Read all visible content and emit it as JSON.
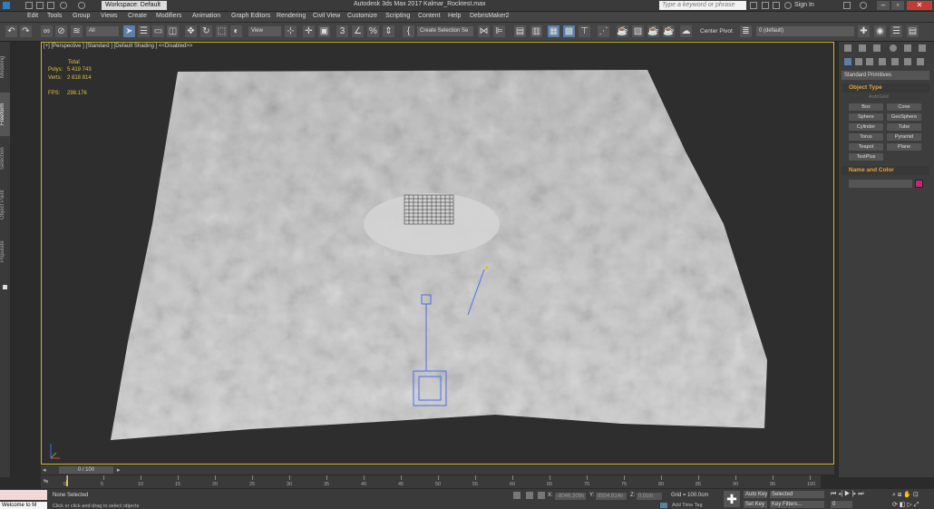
{
  "titlebar": {
    "workspace": "Workspace: Default",
    "title": "Autodesk 3ds Max 2017    Kalmar_Rocktest.max",
    "search_placeholder": "Type a keyword or phrase",
    "sign_in": "Sign In"
  },
  "menu": [
    "Edit",
    "Tools",
    "Group",
    "Views",
    "Create",
    "Modifiers",
    "Animation",
    "Graph Editors",
    "Rendering",
    "Civil View",
    "Customize",
    "Scripting",
    "Content",
    "Help",
    "DebrisMaker2"
  ],
  "toolbar": {
    "selection_filter": "All",
    "ref_coord": "View",
    "selection_set": "Create Selection Se",
    "center_pivot": "Center Pivot",
    "layer": "0 (default)"
  },
  "ribbon_tabs": [
    "Modeling",
    "Freeform",
    "Selection",
    "Object Paint",
    "Populate"
  ],
  "viewport": {
    "label": "[+] [Perspective ] [Standard ] [Default Shading ]  <<Disabled>>",
    "stats": {
      "total_label": "Total",
      "polys_label": "Polys:",
      "polys": "5 419 743",
      "verts_label": "Verts:",
      "verts": "2 818 814",
      "fps_label": "FPS:",
      "fps": "298.176"
    }
  },
  "command_panel": {
    "category": "Standard Primitives",
    "object_type_header": "Object Type",
    "autogrid": "AutoGrid",
    "buttons": [
      "Box",
      "Cone",
      "Sphere",
      "GeoSphere",
      "Cylinder",
      "Tube",
      "Torus",
      "Pyramid",
      "Teapot",
      "Plane",
      "TextPlus"
    ],
    "name_color_header": "Name and Color",
    "color_swatch": "#c0287a"
  },
  "timeline": {
    "frame": "0 / 100",
    "ticks": [
      "0",
      "5",
      "10",
      "15",
      "20",
      "25",
      "30",
      "35",
      "40",
      "45",
      "50",
      "55",
      "60",
      "65",
      "70",
      "75",
      "80",
      "85",
      "90",
      "95",
      "100"
    ]
  },
  "status": {
    "welcome": "Welcome to M",
    "selected": "None Selected",
    "prompt": "Click or click-and-drag to select objects",
    "x_label": "X:",
    "x": "-8046.309n",
    "y_label": "Y:",
    "y": "8504.614n",
    "z_label": "Z:",
    "z": "0.0cm",
    "grid": "Grid = 100.0cm",
    "add_time_tag": "Add Time Tag",
    "auto_key": "Auto Key",
    "set_key": "Set Key",
    "key_mode": "Selected",
    "key_filters": "Key Filters...",
    "frame_field": "0"
  },
  "colors": {
    "accent": "#5b7fa8",
    "viewport_border": "#d6b236",
    "stats": "#e4c13b",
    "rollout_header": "#e4a33b"
  }
}
